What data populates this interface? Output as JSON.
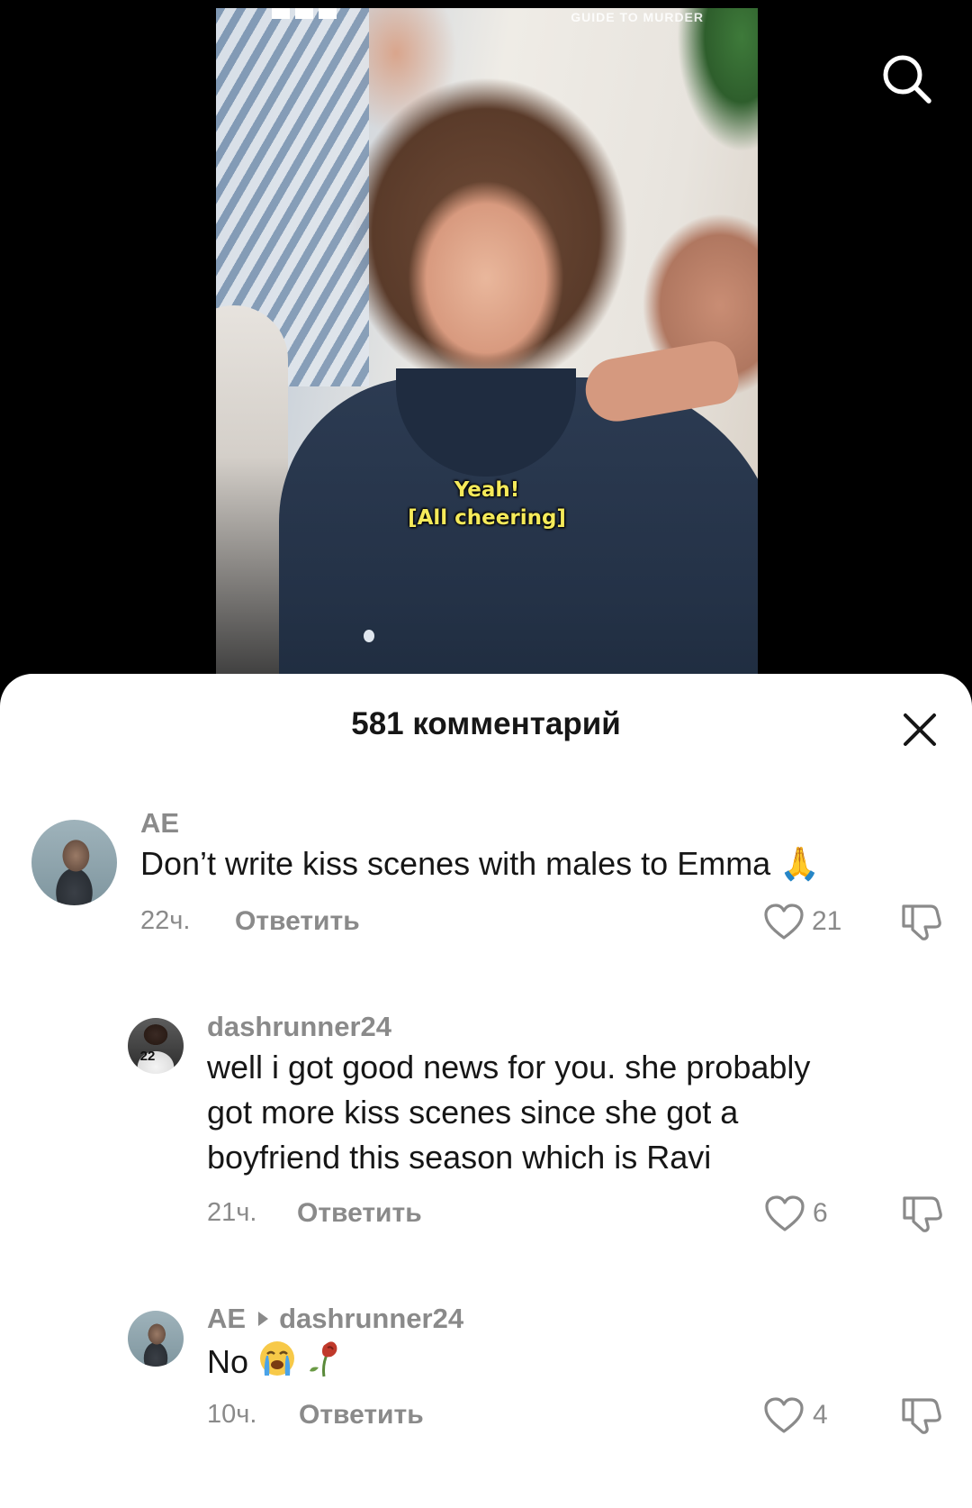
{
  "video": {
    "watermark_left": "BBC",
    "watermark_right": "GUIDE TO MURDER",
    "subtitle_line1": "Yeah!",
    "subtitle_line2": "[All cheering]"
  },
  "comments_sheet": {
    "title": "581 комментарий"
  },
  "comments": [
    {
      "username": "AE",
      "text": "Don’t write kiss scenes with males to Emma 🙏",
      "time": "22ч.",
      "reply_label": "Ответить",
      "likes": "21"
    },
    {
      "username": "dashrunner24",
      "avatar_jersey": "22",
      "text_line1": "well i got good news for you. she probably",
      "text_line2": "got more kiss scenes since she got a",
      "text_line3": "boyfriend this season which is Ravi",
      "time": "21ч.",
      "reply_label": "Ответить",
      "likes": "6"
    },
    {
      "username": "AE",
      "reply_to": "dashrunner24",
      "text": "No",
      "time": "10ч.",
      "reply_label": "Ответить",
      "likes": "4"
    }
  ],
  "icons": {
    "search": "search-icon",
    "close": "close-icon",
    "like": "heart-icon",
    "dislike": "thumbs-down-icon"
  },
  "colors": {
    "secondary_text": "#8a8a8a",
    "primary_text": "#161616",
    "subtitle": "#f5ea5a"
  }
}
